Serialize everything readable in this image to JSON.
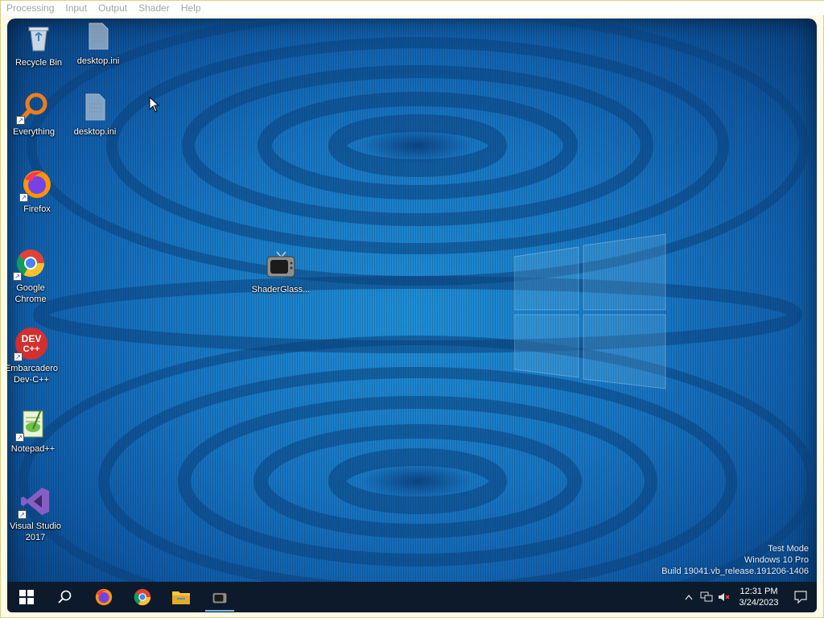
{
  "menubar": {
    "items": [
      "Processing",
      "Input",
      "Output",
      "Shader",
      "Help"
    ]
  },
  "desktop": {
    "icons": [
      {
        "label": "Recycle Bin",
        "icon": "recycle-bin-icon"
      },
      {
        "label": "desktop.ini",
        "icon": "ini-file-icon"
      },
      {
        "label": "Everything",
        "icon": "everything-search-icon"
      },
      {
        "label": "desktop.ini",
        "icon": "ini-file-icon"
      },
      {
        "label": "Firefox",
        "icon": "firefox-icon"
      },
      {
        "label": "Google\nChrome",
        "icon": "chrome-icon"
      },
      {
        "label": "Embarcadero\nDev-C++",
        "icon": "devcpp-icon"
      },
      {
        "label": "Notepad++",
        "icon": "notepadpp-icon"
      },
      {
        "label": "Visual Studio\n2017",
        "icon": "visual-studio-icon"
      },
      {
        "label": "ShaderGlass...",
        "icon": "crt-tv-icon"
      }
    ],
    "devcpp_glyph_text": "DEV\nC++"
  },
  "watermark": {
    "line1": "Test Mode",
    "line2": "Windows 10 Pro",
    "line3": "Build 19041.vb_release.191206-1406"
  },
  "taskbar": {
    "buttons": [
      "start-icon",
      "search-icon",
      "firefox-icon",
      "chrome-icon",
      "file-explorer-icon",
      "shaderglass-icon"
    ],
    "active_button": "shaderglass-icon"
  },
  "tray": {
    "time": "12:31 PM",
    "date": "3/24/2023",
    "icons": [
      "chevron-up-icon",
      "network-icon",
      "volume-muted-icon",
      "notification-icon"
    ]
  },
  "colors": {
    "wallpaper_main": "#1775c2",
    "wallpaper_dark": "#0a3f7c",
    "taskbar": "#0d1a2b",
    "menu_text": "#a3a3a3"
  }
}
